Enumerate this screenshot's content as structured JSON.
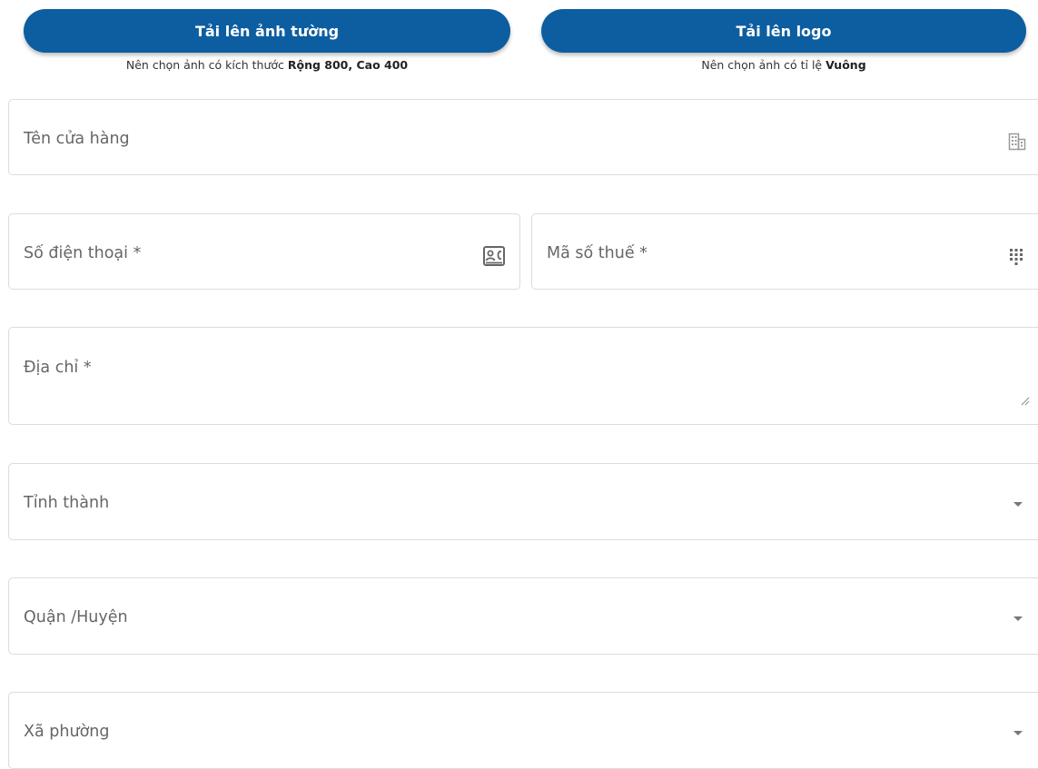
{
  "uploads": {
    "cover": {
      "button_label": "Tải lên ảnh tường",
      "hint_prefix": "Nên chọn ảnh có kích thước ",
      "hint_bold": "Rộng 800, Cao 400"
    },
    "logo": {
      "button_label": "Tải lên logo",
      "hint_prefix": "Nên chọn ảnh có tỉ lệ ",
      "hint_bold": "Vuông"
    }
  },
  "form": {
    "store_name": {
      "placeholder": "Tên cửa hàng",
      "icon": "building-icon"
    },
    "phone": {
      "placeholder": "Số điện thoại *",
      "icon": "contact-phone-icon"
    },
    "tax_code": {
      "placeholder": "Mã số thuế *",
      "icon": "dialpad-icon"
    },
    "address": {
      "placeholder": "Địa chỉ *"
    },
    "province": {
      "placeholder": "Tỉnh thành",
      "icon": "caret-down-icon"
    },
    "district": {
      "placeholder": "Quận /Huyện",
      "icon": "caret-down-icon"
    },
    "ward": {
      "placeholder": "Xã phường",
      "icon": "caret-down-icon"
    }
  },
  "colors": {
    "primary": "#0d5ea0",
    "border": "#dcdcdc",
    "placeholder_text": "#666666"
  }
}
